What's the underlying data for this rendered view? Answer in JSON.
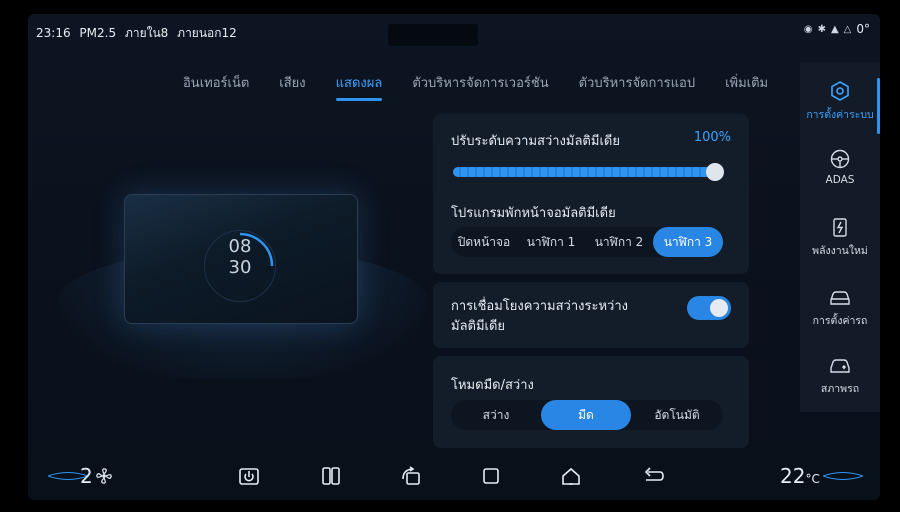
{
  "status_bar": {
    "time": "23:16",
    "pm25_label": "PM2.5",
    "inside_label": "ภายใน8",
    "outside_label": "ภายนอก12",
    "temp_outside": "0°"
  },
  "tabs": [
    {
      "label": "อินเทอร์เน็ต"
    },
    {
      "label": "เสียง"
    },
    {
      "label": "แสดงผล",
      "active": true
    },
    {
      "label": "ตัวบริหารจัดการเวอร์ชัน"
    },
    {
      "label": "ตัวบริหารจัดการแอป"
    },
    {
      "label": "เพิ่มเติม"
    }
  ],
  "preview": {
    "clock_hour": "08",
    "clock_minute": "30"
  },
  "brightness": {
    "label": "ปรับระดับความสว่างมัลติมีเดีย",
    "value_text": "100%",
    "value": 1.0
  },
  "screensaver": {
    "label": "โปรแกรมพักหน้าจอมัลติมีเดีย",
    "options": [
      "ปิดหน้าจอ",
      "นาฬิกา 1",
      "นาฬิกา 2",
      "นาฬิกา 3"
    ],
    "selected": "นาฬิกา 3"
  },
  "brightness_link": {
    "label_line1": "การเชื่อมโยงความสว่างระหว่าง",
    "label_line2": "มัลติมีเดีย",
    "enabled": true
  },
  "dark_mode": {
    "label": "โหมดมืด/สว่าง",
    "options": [
      "สว่าง",
      "มืด",
      "อัตโนมัติ"
    ],
    "selected": "มืด"
  },
  "sidebar": {
    "items": [
      {
        "label": "การตั้งค่าระบบ",
        "icon": "settings-hex-icon",
        "active": true
      },
      {
        "label": "ADAS",
        "icon": "steering-wheel-icon"
      },
      {
        "label": "พลังงานใหม่",
        "icon": "battery-charge-icon"
      },
      {
        "label": "การตั้งค่ารถ",
        "icon": "car-icon"
      },
      {
        "label": "สภาพรถ",
        "icon": "car-health-icon"
      }
    ]
  },
  "bottom_bar": {
    "fan_level": "2",
    "temperature": "22",
    "temp_unit": "°C"
  },
  "colors": {
    "accent": "#2f93f2",
    "background": "#0b121d",
    "card": "#131d2a"
  }
}
